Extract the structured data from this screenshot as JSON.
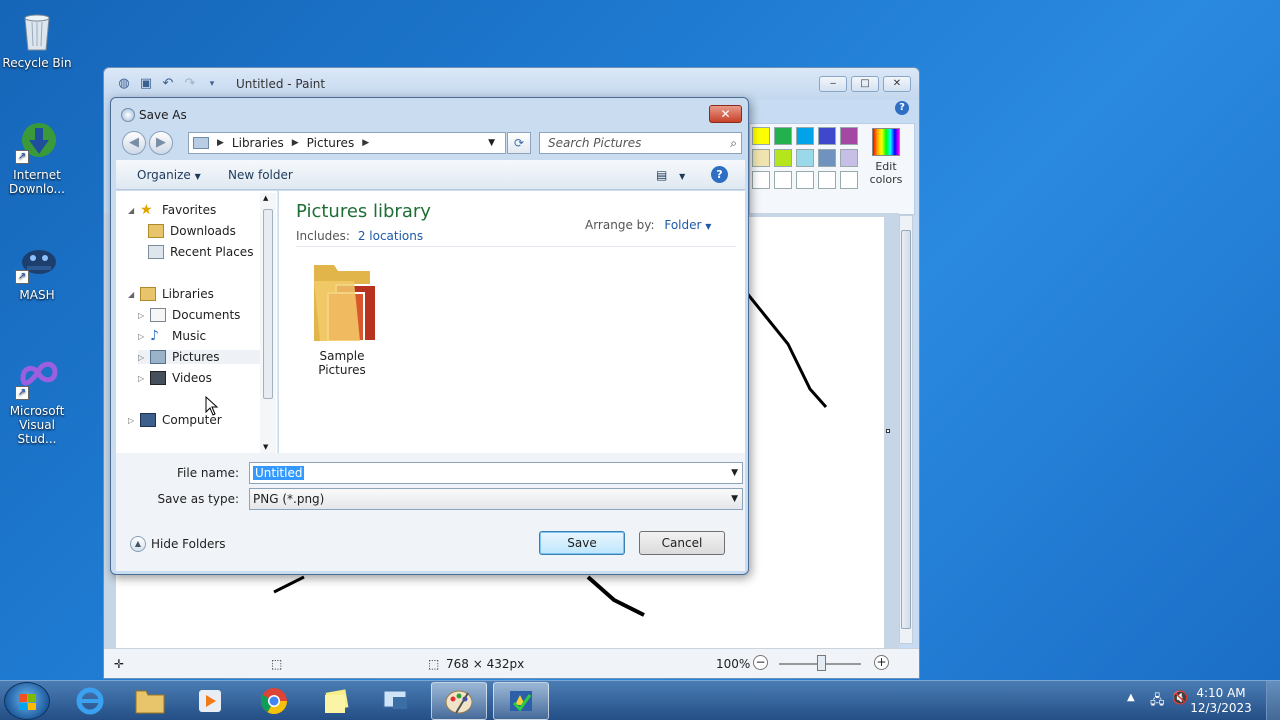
{
  "desktop": {
    "icons": [
      {
        "label": "Recycle Bin"
      },
      {
        "label": "Internet Downlo..."
      },
      {
        "label": "MASH"
      },
      {
        "label": "Microsoft Visual Stud..."
      }
    ]
  },
  "paint": {
    "title": "Untitled - Paint",
    "edit_colors": "Edit colors",
    "palette": [
      "#ffff00",
      "#22b14c",
      "#00a2e8",
      "#3f48cc",
      "#a349a4",
      "#efe4b0",
      "#b5e61d",
      "#99d9ea",
      "#7092be",
      "#c8bfe7",
      "#ffffff",
      "#ffffff",
      "#ffffff",
      "#ffffff",
      "#ffffff"
    ],
    "status": {
      "dimensions": "768 × 432px",
      "zoom": "100%"
    }
  },
  "dialog": {
    "title": "Save As",
    "breadcrumb": [
      "Libraries",
      "Pictures"
    ],
    "search_placeholder": "Search Pictures",
    "toolbar": {
      "organize": "Organize",
      "new_folder": "New folder"
    },
    "nav": {
      "favorites": "Favorites",
      "downloads": "Downloads",
      "recent_places": "Recent Places",
      "libraries": "Libraries",
      "documents": "Documents",
      "music": "Music",
      "pictures": "Pictures",
      "videos": "Videos",
      "computer": "Computer"
    },
    "content": {
      "title": "Pictures library",
      "includes_label": "Includes:",
      "includes_link": "2 locations",
      "arrange_label": "Arrange by:",
      "arrange_value": "Folder",
      "items": [
        {
          "name": "Sample Pictures"
        }
      ]
    },
    "file_name_label": "File name:",
    "file_name_value": "Untitled",
    "save_type_label": "Save as type:",
    "save_type_value": "PNG (*.png)",
    "hide_folders": "Hide Folders",
    "save": "Save",
    "cancel": "Cancel"
  },
  "taskbar": {
    "time": "4:10 AM",
    "date": "12/3/2023"
  }
}
